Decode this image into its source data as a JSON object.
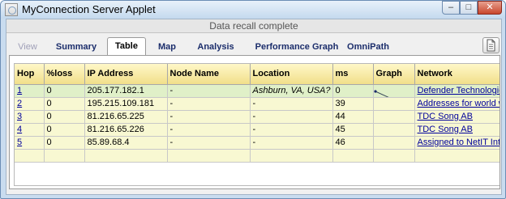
{
  "window": {
    "title": "MyConnection Server Applet",
    "min_glyph": "–",
    "max_glyph": "□",
    "close_glyph": "✕"
  },
  "status": "Data recall complete",
  "tabs": [
    {
      "label": "View",
      "state": "disabled"
    },
    {
      "label": "Summary",
      "state": "normal"
    },
    {
      "label": "Table",
      "state": "active"
    },
    {
      "label": "Map",
      "state": "normal"
    },
    {
      "label": "Analysis",
      "state": "normal"
    },
    {
      "label": "Performance Graph",
      "state": "normal"
    },
    {
      "label": "OmniPath",
      "state": "normal"
    }
  ],
  "toolbar": {
    "document_icon": "document-icon"
  },
  "table": {
    "columns": [
      "Hop",
      "%loss",
      "IP Address",
      "Node Name",
      "Location",
      "ms",
      "Graph",
      "Network"
    ],
    "rows": [
      {
        "hop": "1",
        "loss": "0",
        "ip": "205.177.182.1",
        "node": "-",
        "location": "Ashburn, VA, USA?",
        "ms": "0",
        "ms_value": 0,
        "network": "Defender Technologies Group"
      },
      {
        "hop": "2",
        "loss": "0",
        "ip": "195.215.109.181",
        "node": "-",
        "location": "-",
        "ms": "39",
        "ms_value": 39,
        "network": "Addresses for world wide"
      },
      {
        "hop": "3",
        "loss": "0",
        "ip": "81.216.65.225",
        "node": "-",
        "location": "-",
        "ms": "44",
        "ms_value": 44,
        "network": "TDC Song AB"
      },
      {
        "hop": "4",
        "loss": "0",
        "ip": "81.216.65.226",
        "node": "-",
        "location": "-",
        "ms": "45",
        "ms_value": 45,
        "network": "TDC Song AB"
      },
      {
        "hop": "5",
        "loss": "0",
        "ip": "85.89.68.4",
        "node": "-",
        "location": "-",
        "ms": "46",
        "ms_value": 46,
        "network": "Assigned to NetIT Internet"
      }
    ]
  },
  "colors": {
    "header_gradient_top": "#fff8c8",
    "header_gradient_bottom": "#f1df8a",
    "first_row": "#e0f0c8",
    "rows": "#f8f8d2",
    "link": "#00009c"
  }
}
